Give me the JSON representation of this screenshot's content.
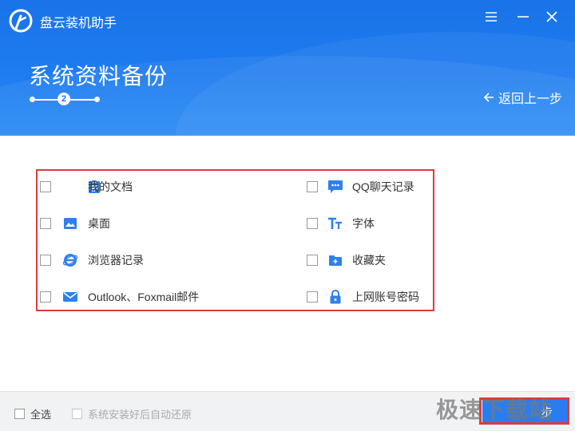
{
  "app": {
    "title": "盘云装机助手"
  },
  "header": {
    "page_title": "系统资料备份",
    "current_step": "2",
    "back_label": "返回上一步"
  },
  "options": [
    {
      "label": "我的文档",
      "icon": "document-icon",
      "checked": false
    },
    {
      "label": "QQ聊天记录",
      "icon": "chat-icon",
      "checked": false
    },
    {
      "label": "桌面",
      "icon": "desktop-image-icon",
      "checked": false
    },
    {
      "label": "字体",
      "icon": "font-icon",
      "checked": false
    },
    {
      "label": "浏览器记录",
      "icon": "ie-browser-icon",
      "checked": false
    },
    {
      "label": "收藏夹",
      "icon": "favorites-folder-icon",
      "checked": false
    },
    {
      "label": "Outlook、Foxmail邮件",
      "icon": "mail-icon",
      "checked": false
    },
    {
      "label": "上网账号密码",
      "icon": "lock-icon",
      "checked": false
    }
  ],
  "footer": {
    "select_all_label": "全选",
    "auto_restore_label": "系统安装好后自动还原",
    "next_label": "步"
  },
  "watermark": "极速下载站",
  "colors": {
    "accent": "#1a73e8",
    "highlight_border": "#e03a3a",
    "icon_blue": "#2f80ed"
  }
}
